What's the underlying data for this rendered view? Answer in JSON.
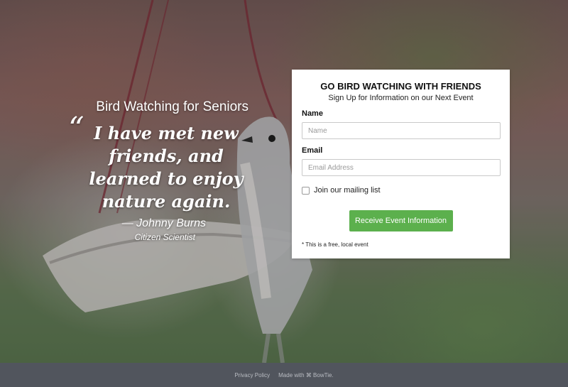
{
  "hero": {
    "heading": "Bird Watching for Seniors",
    "quote_mark": "“",
    "quote": "I have met new friends, and learned to enjoy nature again.",
    "author": "— Johnny Burns",
    "author_role": "Citizen Scientist"
  },
  "form": {
    "title": "GO BIRD WATCHING WITH FRIENDS",
    "subtitle": "Sign Up for Information on our Next Event",
    "name_label": "Name",
    "name_placeholder": "Name",
    "email_label": "Email",
    "email_placeholder": "Email Address",
    "mailing_list_label": "Join our mailing list",
    "mailing_list_checked": false,
    "submit_label": "Receive Event Information",
    "fine_print": "* This is a free, local event"
  },
  "footer": {
    "privacy_label": "Privacy Policy",
    "made_with_label": "Made with ⌘ BowTie."
  },
  "colors": {
    "button": "#5cb04d",
    "footer_bg": "#51555d"
  }
}
